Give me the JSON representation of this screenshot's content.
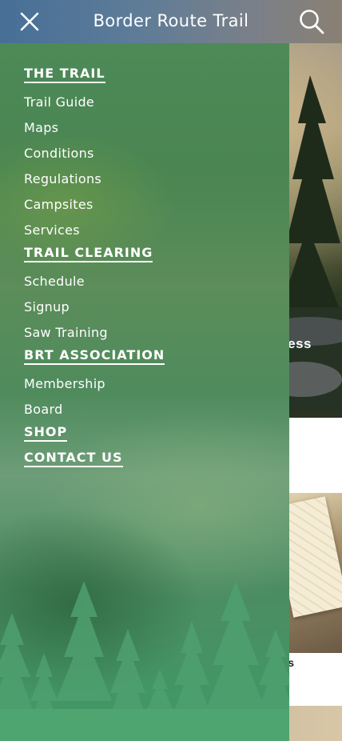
{
  "header": {
    "title": "Border Route Trail",
    "close_icon": "close-icon",
    "search_icon": "search-icon"
  },
  "background": {
    "hero_caption": "ess",
    "card_caption": "s"
  },
  "drawer": {
    "sections": [
      {
        "title": "THE TRAIL",
        "items": [
          "Trail Guide",
          "Maps",
          "Conditions",
          "Regulations",
          "Campsites",
          "Services"
        ]
      },
      {
        "title": "TRAIL CLEARING",
        "items": [
          "Schedule",
          "Signup",
          "Saw Training"
        ]
      },
      {
        "title": "BRT ASSOCIATION",
        "items": [
          "Membership",
          "Board"
        ]
      },
      {
        "title": "SHOP",
        "items": []
      },
      {
        "title": "CONTACT US",
        "items": []
      }
    ]
  },
  "colors": {
    "header_start": "#476f97",
    "header_end": "#8a8073",
    "drawer_green": "#4d8a57",
    "forest_green": "#3f9a66",
    "text": "#ffffff"
  }
}
